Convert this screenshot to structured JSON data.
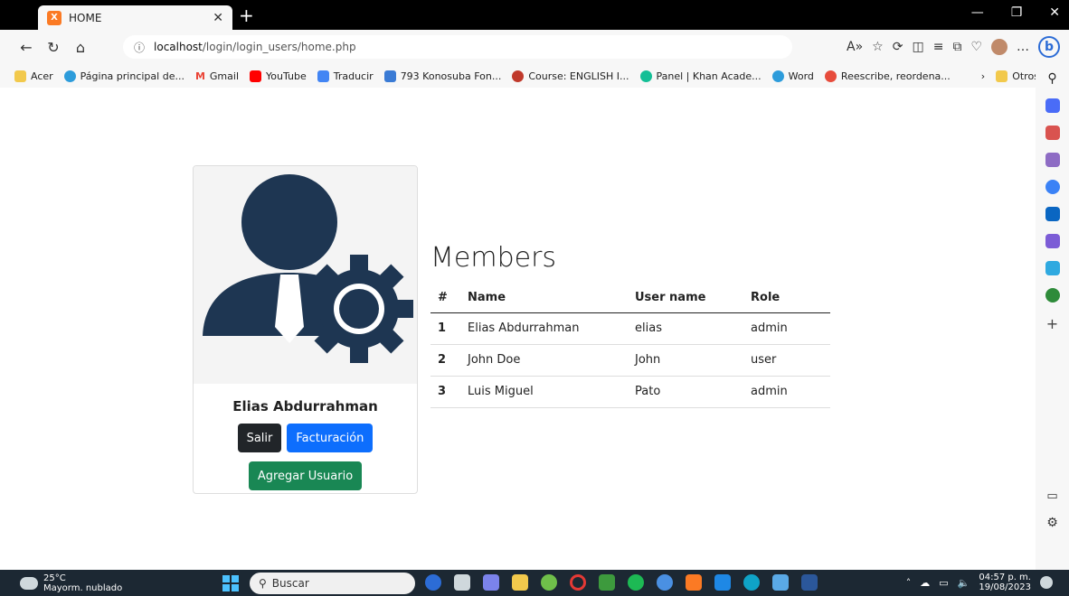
{
  "browser": {
    "tab_title": "HOME",
    "tab_favicon": "X",
    "url_host": "localhost",
    "url_path": "/login/login_users/home.php",
    "colors": {
      "chrome": "#000000",
      "toolbar": "#f7f7f7"
    }
  },
  "bookmarks": [
    {
      "label": "Acer",
      "color": "#f2c94c"
    },
    {
      "label": "Página principal de...",
      "color": "#2d9cdb"
    },
    {
      "label": "Gmail",
      "color": "#ea4335"
    },
    {
      "label": "YouTube",
      "color": "#ff0000"
    },
    {
      "label": "Traducir",
      "color": "#4285f4"
    },
    {
      "label": "793 Konosuba Fon...",
      "color": "#3a7bd5"
    },
    {
      "label": "Course: ENGLISH I...",
      "color": "#c0392b"
    },
    {
      "label": "Panel | Khan Acade...",
      "color": "#14bf96"
    },
    {
      "label": "Word",
      "color": "#2d9cdb"
    },
    {
      "label": "Reescribe, reordena...",
      "color": "#e74c3c"
    }
  ],
  "bookmarks_other": "Otros favoritos",
  "profile": {
    "name": "Elias Abdurrahman",
    "btn_logout": "Salir",
    "btn_billing": "Facturación",
    "btn_add_user": "Agregar Usuario",
    "avatar_color": "#1e3652"
  },
  "members": {
    "title": "Members",
    "headers": [
      "#",
      "Name",
      "User name",
      "Role"
    ],
    "rows": [
      [
        "1",
        "Elias Abdurrahman",
        "elias",
        "admin"
      ],
      [
        "2",
        "John Doe",
        "John",
        "user"
      ],
      [
        "3",
        "Luis Miguel",
        "Pato",
        "admin"
      ]
    ]
  },
  "taskbar": {
    "temp": "25°C",
    "weather": "Mayorm. nublado",
    "search_placeholder": "Buscar",
    "time": "04:57 p. m.",
    "date": "19/08/2023"
  }
}
